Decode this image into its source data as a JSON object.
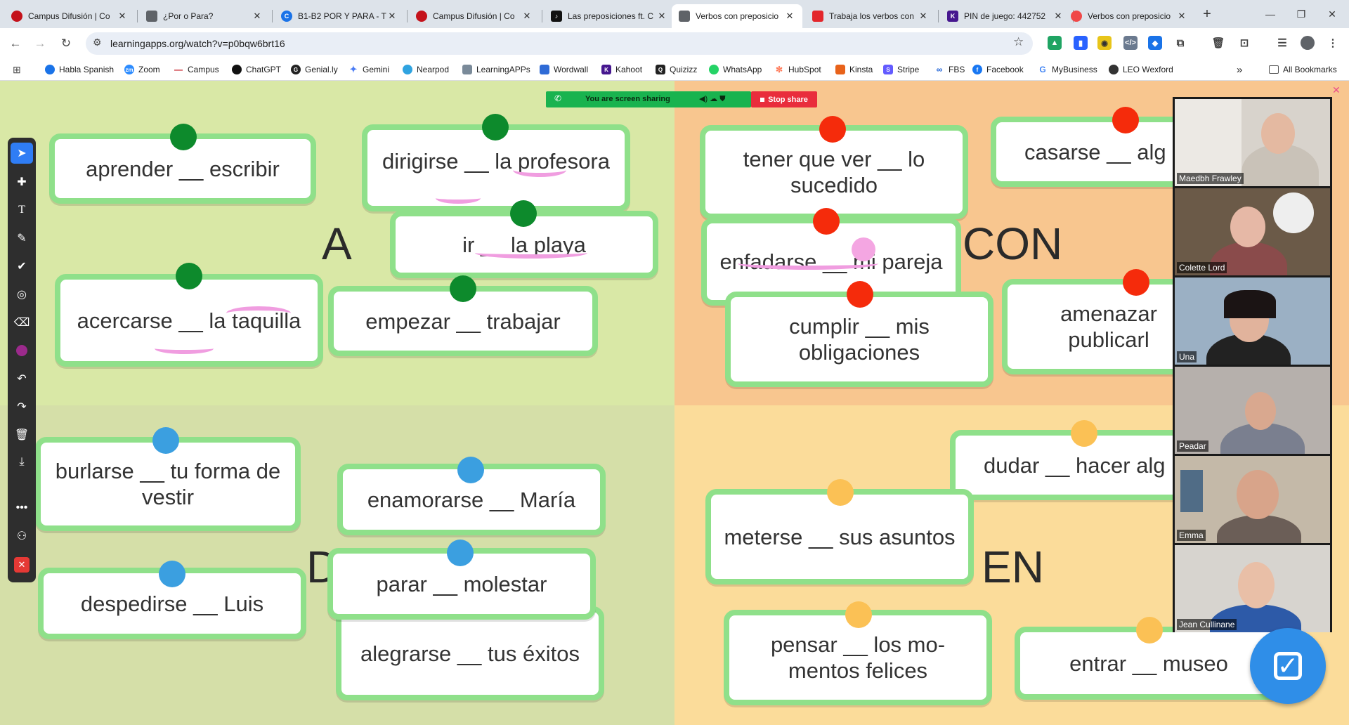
{
  "browser": {
    "tabs": [
      {
        "title": "Campus Difusión | Co",
        "fav_color": "#c4121b",
        "fav_glyph": ""
      },
      {
        "title": "¿Por o Para?",
        "fav_color": "#5f6368",
        "fav_glyph": ""
      },
      {
        "title": "B1-B2 POR Y PARA - T",
        "fav_color": "#1a73e8",
        "fav_glyph": "C"
      },
      {
        "title": "Campus Difusión | Co",
        "fav_color": "#c4121b",
        "fav_glyph": ""
      },
      {
        "title": "Las preposiciones ft. C",
        "fav_color": "#111111",
        "fav_glyph": "♪"
      },
      {
        "title": "Verbos con preposicio",
        "fav_color": "#5f6368",
        "fav_glyph": ""
      },
      {
        "title": "Trabaja los verbos con",
        "fav_color": "#e3262b",
        "fav_glyph": ""
      },
      {
        "title": "PIN de juego: 442752",
        "fav_color": "#46178f",
        "fav_glyph": "K"
      },
      {
        "title": "Verbos con preposicio",
        "fav_color": "#f04848",
        "fav_glyph": ""
      }
    ],
    "active_tab": 5,
    "url": "learningapps.org/watch?v=p0bqw6brt16",
    "bookmarks": [
      {
        "label": "Habla Spanish",
        "color": "#1a73e8"
      },
      {
        "label": "Zoom",
        "color": "#2d8cff"
      },
      {
        "label": "Campus",
        "color": "#c4121b"
      },
      {
        "label": "ChatGPT",
        "color": "#111111"
      },
      {
        "label": "Genial.ly",
        "color": "#222222"
      },
      {
        "label": "Gemini",
        "color": "#4a7cf5"
      },
      {
        "label": "Nearpod",
        "color": "#2fa3e0"
      },
      {
        "label": "LearningAPPs",
        "color": "#7a8a99"
      },
      {
        "label": "Wordwall",
        "color": "#2f6bd6"
      },
      {
        "label": "Kahoot",
        "color": "#46178f"
      },
      {
        "label": "Quizizz",
        "color": "#222222"
      },
      {
        "label": "WhatsApp",
        "color": "#25d366"
      },
      {
        "label": "HubSpot",
        "color": "#ff7a59"
      },
      {
        "label": "Kinsta",
        "color": "#e8621a"
      },
      {
        "label": "Stripe",
        "color": "#635bff"
      },
      {
        "label": "FBS",
        "color": "#1e62d6"
      },
      {
        "label": "Facebook",
        "color": "#1877f2"
      },
      {
        "label": "MyBusiness",
        "color": "#4285f4"
      },
      {
        "label": "LEO Wexford",
        "color": "#333333"
      }
    ],
    "bookmarks_overflow": "»",
    "all_bookmarks": "All Bookmarks"
  },
  "exercise": {
    "groups": [
      {
        "label": "A",
        "color": "#0d8a2c"
      },
      {
        "label": "CON",
        "color": "#f52b0b"
      },
      {
        "label": "D",
        "color": "#3b9fe0"
      },
      {
        "label": "EN",
        "color": "#fbc155"
      }
    ],
    "cards": [
      {
        "text": "aprender __ escribir",
        "group": "A"
      },
      {
        "text": "dirigirse __ la profesora",
        "group": "A"
      },
      {
        "text": "ir __ la playa",
        "group": "A"
      },
      {
        "text": "acercarse __ la taquilla",
        "group": "A"
      },
      {
        "text": "empezar __ trabajar",
        "group": "A"
      },
      {
        "text": "tener que ver __ lo sucedido",
        "group": "CON"
      },
      {
        "text": "casarse __ alg",
        "group": "CON"
      },
      {
        "text": "enfadarse __ mi pareja",
        "group": "CON"
      },
      {
        "text": "cumplir __ mis obligaciones",
        "group": "CON"
      },
      {
        "text": "amenazar publicarl",
        "group": "CON"
      },
      {
        "text": "burlarse __ tu forma de vestir",
        "group": "D"
      },
      {
        "text": "enamorarse __ María",
        "group": "D"
      },
      {
        "text": "despedirse __ Luis",
        "group": "D"
      },
      {
        "text": "parar __ molestar",
        "group": "D"
      },
      {
        "text": "alegrarse __ tus éxitos",
        "group": "D"
      },
      {
        "text": "dudar __ hacer alg",
        "group": "EN"
      },
      {
        "text": "meterse __ sus asuntos",
        "group": "EN"
      },
      {
        "text": "pensar __ los mo-mentos felices",
        "group": "EN"
      },
      {
        "text": "entrar __ museo",
        "group": "EN"
      }
    ]
  },
  "screen_share": {
    "status": "You are screen sharing",
    "stop_label": "Stop share",
    "bar_color": "#19b34f",
    "stop_color": "#e92d3c"
  },
  "participants": [
    {
      "name": "Maedbh Frawley"
    },
    {
      "name": "Colette Lord"
    },
    {
      "name": "Una"
    },
    {
      "name": "Peadar"
    },
    {
      "name": "Emma"
    },
    {
      "name": "Jean Cullinane"
    }
  ],
  "tools": [
    "select-icon",
    "move-icon",
    "text-icon",
    "pen-icon",
    "check-icon",
    "spotlight-icon",
    "eraser-icon",
    "color-dot-icon",
    "undo-icon",
    "redo-icon",
    "trash-icon",
    "download-icon",
    "more-icon",
    "annotator-icon",
    "close-icon"
  ]
}
